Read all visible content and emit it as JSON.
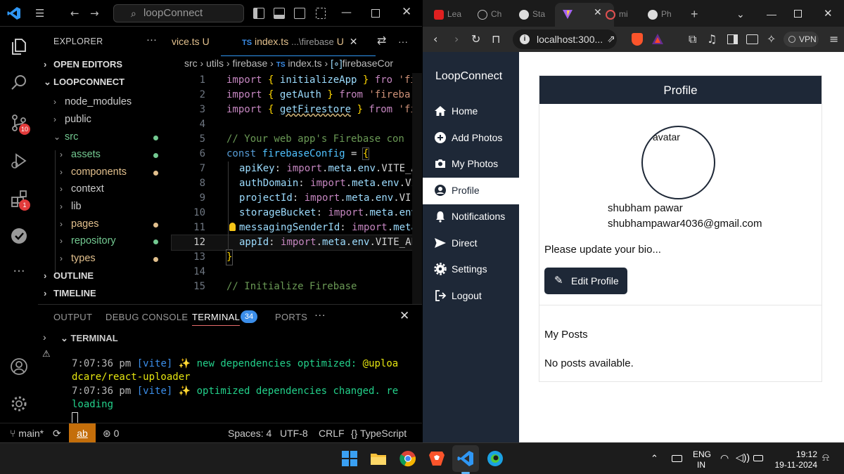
{
  "vscode": {
    "search": "loopConnect",
    "explorer": {
      "title": "EXPLORER",
      "open_editors": "OPEN EDITORS",
      "project": "LOOPCONNECT",
      "outline": "OUTLINE",
      "timeline": "TIMELINE",
      "items": [
        {
          "label": "node_modules",
          "color": "#cccccc"
        },
        {
          "label": "public",
          "color": "#cccccc"
        },
        {
          "label": "src",
          "color": "#73c991"
        },
        {
          "label": "assets",
          "color": "#73c991"
        },
        {
          "label": "components",
          "color": "#e2c08d"
        },
        {
          "label": "context",
          "color": "#cccccc"
        },
        {
          "label": "lib",
          "color": "#cccccc"
        },
        {
          "label": "pages",
          "color": "#e2c08d"
        },
        {
          "label": "repository",
          "color": "#73c991"
        },
        {
          "label": "types",
          "color": "#e2c08d"
        }
      ]
    },
    "activity_badges": {
      "source_control": "10",
      "extensions": "1"
    },
    "tabs": {
      "tab1": "vice.ts",
      "tab1_status": "U",
      "tab2_lang": "TS",
      "tab2_name": "index.ts",
      "tab2_path": "...\\firebase",
      "tab2_status": "U"
    },
    "breadcrumbs": {
      "p1": "src",
      "p2": "utils",
      "p3": "firebase",
      "lang": "TS",
      "file": "index.ts",
      "symbol_icon": "[∘]",
      "symbol": "firebaseCor"
    },
    "code": {
      "line_numbers": [
        "1",
        "2",
        "3",
        "4",
        "5",
        "6",
        "7",
        "8",
        "9",
        "10",
        "11",
        "12",
        "13",
        "14",
        "15"
      ],
      "l1": [
        "import",
        "{",
        "initializeApp",
        "}",
        "fro",
        "'fi"
      ],
      "l2": [
        "import",
        "{",
        "getAuth",
        "}",
        "from",
        "'fireba"
      ],
      "l3": [
        "import",
        "{",
        "getFirestore",
        "}",
        "from",
        "'fi"
      ],
      "l5": "// Your web app's Firebase con",
      "l6": [
        "const",
        "firebaseConfig",
        "=",
        "{"
      ],
      "props": [
        {
          "key": "apiKey",
          "tail": "VITE_A"
        },
        {
          "key": "authDomain",
          "tail": "VI"
        },
        {
          "key": "projectId",
          "tail": "VI"
        },
        {
          "key": "storageBucket",
          "tail": ""
        },
        {
          "key": "messagingSenderId",
          "tail": ""
        },
        {
          "key": "appId",
          "tail": "VITE_AP"
        }
      ],
      "import_meta_env": [
        "import",
        "meta",
        "env"
      ],
      "l13": "}",
      "l15": "// Initialize Firebase"
    },
    "panel": {
      "tabs": [
        "OUTPUT",
        "DEBUG CONSOLE",
        "TERMINAL",
        "PORTS"
      ],
      "terminal_badge": "34",
      "terminal_title": "TERMINAL",
      "lines": [
        {
          "time": "7:07:36 pm",
          "tag": "[vite]",
          "spark": "✨",
          "msg": "new dependencies optimized:",
          "pkg": "@uploa"
        },
        {
          "cont": "dcare/react-uploader"
        },
        {
          "time": "7:07:36 pm",
          "tag": "[vite]",
          "spark": "✨",
          "msg": "optimized dependencies changed. re"
        },
        {
          "cont": "loading"
        }
      ]
    },
    "status": {
      "branch": "main*",
      "ab": "ab",
      "ports": "0",
      "spaces": "Spaces: 4",
      "encoding": "UTF-8",
      "eol": "CRLF",
      "lang_brackets": "{}",
      "language": "TypeScript"
    }
  },
  "browser": {
    "tabs": [
      "Lea",
      "Ch",
      "Sta",
      "mi",
      "Ph"
    ],
    "url": "localhost:300...",
    "vpn": "VPN",
    "app": {
      "brand": "LoopConnect",
      "nav": [
        {
          "label": "Home",
          "icon": "home-icon"
        },
        {
          "label": "Add Photos",
          "icon": "plus-circle-icon"
        },
        {
          "label": "My Photos",
          "icon": "camera-icon"
        },
        {
          "label": "Profile",
          "icon": "user-circle-icon",
          "active": true
        },
        {
          "label": "Notifications",
          "icon": "bell-icon"
        },
        {
          "label": "Direct",
          "icon": "send-icon"
        },
        {
          "label": "Settings",
          "icon": "gear-icon"
        },
        {
          "label": "Logout",
          "icon": "logout-icon"
        }
      ],
      "profile": {
        "header": "Profile",
        "avatar_alt": "avatar",
        "name": "shubham pawar",
        "email": "shubhampawar4036@gmail.com",
        "bio": "Please update your bio...",
        "edit_button": "Edit Profile",
        "posts_title": "My Posts",
        "posts_empty": "No posts available."
      }
    }
  },
  "taskbar": {
    "lang": "ENG",
    "region": "IN",
    "time": "19:12",
    "date": "19-11-2024"
  }
}
